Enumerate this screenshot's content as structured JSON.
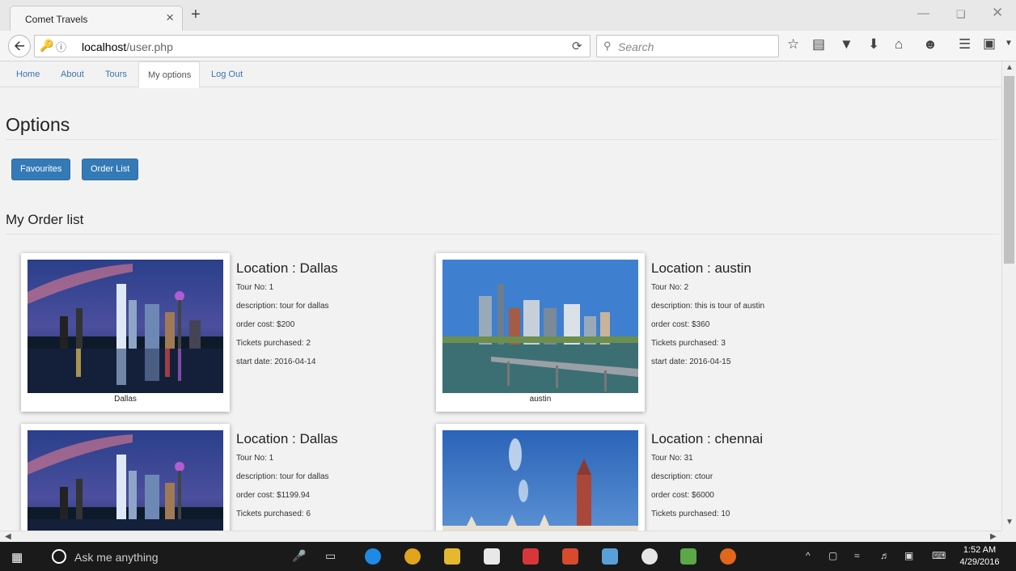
{
  "browser": {
    "tab_title": "Comet Travels",
    "tab_close": "×",
    "new_tab": "+",
    "url_host": "localhost",
    "url_path": "/user.php",
    "search_placeholder": "Search"
  },
  "site_nav": {
    "home": "Home",
    "about": "About",
    "tours": "Tours",
    "my_options": "My options",
    "logout": "Log Out"
  },
  "page": {
    "title": "Options",
    "buttons": {
      "favourites": "Favourites",
      "order_list": "Order List"
    },
    "order_list_title": "My Order list"
  },
  "orders": [
    {
      "caption": "Dallas",
      "location": "Location : Dallas",
      "tour_no": "Tour No: 1",
      "description": "description: tour for dallas",
      "cost": "order cost: $200",
      "tickets": "Tickets purchased: 2",
      "start": "start date: 2016-04-14"
    },
    {
      "caption": "austin",
      "location": "Location : austin",
      "tour_no": "Tour No: 2",
      "description": "description: this is tour of austin",
      "cost": "order cost: $360",
      "tickets": "Tickets purchased: 3",
      "start": "start date: 2016-04-15"
    },
    {
      "location": "Location : Dallas",
      "tour_no": "Tour No: 1",
      "description": "description: tour for dallas",
      "cost": "order cost: $1199.94",
      "tickets": "Tickets purchased: 6"
    },
    {
      "location": "Location : chennai",
      "tour_no": "Tour No: 31",
      "description": "description: ctour",
      "cost": "order cost: $6000",
      "tickets": "Tickets purchased: 10"
    }
  ],
  "taskbar": {
    "search_text": "Ask me anything",
    "time": "1:52 AM",
    "date": "4/29/2016"
  },
  "colors": {
    "accent": "#337ab7",
    "link": "#3a74b3",
    "taskbar": "#1a1a1a"
  }
}
